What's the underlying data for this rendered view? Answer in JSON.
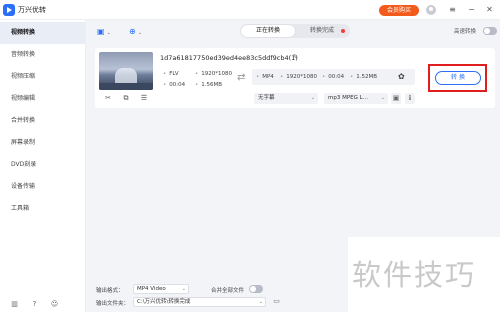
{
  "app": {
    "title": "万兴优转",
    "vip_label": "会员购买"
  },
  "window_controls": {
    "menu": "≡",
    "minimize": "−",
    "close": "✕"
  },
  "sidebar": {
    "items": [
      {
        "label": "视频转换",
        "active": true
      },
      {
        "label": "音频转换"
      },
      {
        "label": "视频压缩"
      },
      {
        "label": "视频编辑"
      },
      {
        "label": "合并转换"
      },
      {
        "label": "屏幕录制"
      },
      {
        "label": "DVD刻录"
      },
      {
        "label": "设备传输"
      },
      {
        "label": "工具箱"
      }
    ],
    "footer_icons": {
      "book": "▥",
      "help": "?",
      "user": "☺"
    }
  },
  "toolbar": {
    "add_file_icon": "▣",
    "add_more_icon": "⊕",
    "chevron": "⌄",
    "tabs": [
      {
        "label": "正在转换",
        "active": true
      },
      {
        "label": "转换完成"
      }
    ],
    "high_speed_label": "高速转换"
  },
  "file": {
    "name": "1d7a61817750ed39ed4ee83c5ddf9cb4(1)",
    "edit_icon": "✎",
    "thumb_tools": {
      "cut": "✂",
      "crop": "⧉",
      "effects": "☰"
    },
    "source": {
      "format": "FLV",
      "resolution": "1920*1080",
      "duration": "00:04",
      "size": "1.56MB"
    },
    "arrow_icon": "⇄",
    "target": {
      "format": "MP4",
      "resolution": "1920*1080",
      "duration": "00:04",
      "size": "1.52MB"
    },
    "gear_icon": "✿",
    "subtitle": "无字幕",
    "audio": "mp3 MPEG L...",
    "image_icon": "▣",
    "info_icon": "ℹ",
    "bullet": "•",
    "dropdown": "⌄",
    "convert_label": "转 换"
  },
  "bottom": {
    "output_format_label": "输出格式：",
    "output_format_value": "MP4 Video",
    "merge_label": "合并全部文件",
    "output_folder_label": "输出文件夹：",
    "output_folder_value": "C:\\万兴优转\\转换完成",
    "folder_icon": "▭",
    "dropdown": "⌄"
  },
  "watermark": "软件技巧",
  "colors": {
    "accent": "#2a6ff6",
    "vip": "#f25b1c",
    "highlight": "#e01e1e"
  }
}
